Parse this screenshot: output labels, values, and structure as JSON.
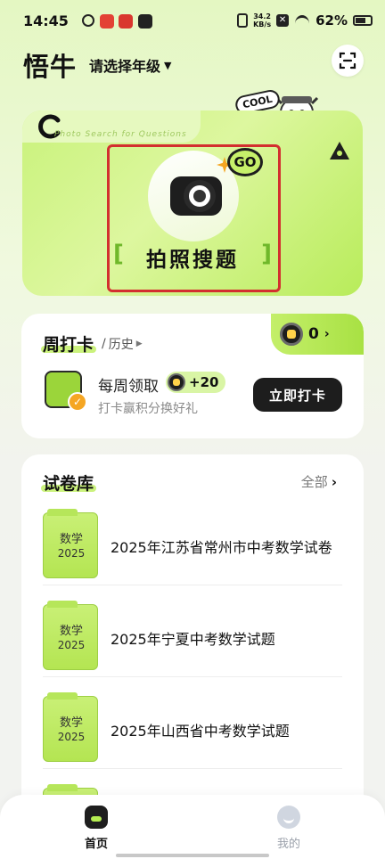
{
  "status_bar": {
    "time": "14:45",
    "net_speed_value": "34.2",
    "net_speed_unit": "KB/s",
    "battery": "62%"
  },
  "header": {
    "app_title": "悟牛",
    "grade_selector": "请选择年级"
  },
  "hero": {
    "label": "拍照搜题",
    "watermark": "Photo Search for Questions",
    "go_text": "GO",
    "cool_text": "COOL"
  },
  "checkin": {
    "title": "周打卡",
    "history_link": "历史",
    "points": "0",
    "reward_title": "每周领取",
    "reward_amount": "+20",
    "reward_desc": "打卡赢积分换好礼",
    "button_label": "立即打卡"
  },
  "library": {
    "title": "试卷库",
    "view_all": "全部",
    "papers": [
      {
        "subject": "数学",
        "year": "2025",
        "title": "2025年江苏省常州市中考数学试卷"
      },
      {
        "subject": "数学",
        "year": "2025",
        "title": "2025年宁夏中考数学试题"
      },
      {
        "subject": "数学",
        "year": "2025",
        "title": "2025年山西省中考数学试题"
      }
    ]
  },
  "bottom_nav": {
    "home_label": "首页",
    "mine_label": "我的"
  },
  "colors": {
    "accent_green": "#c6f06a",
    "dark": "#1d1d1d",
    "highlight_red": "#d32f2f"
  }
}
